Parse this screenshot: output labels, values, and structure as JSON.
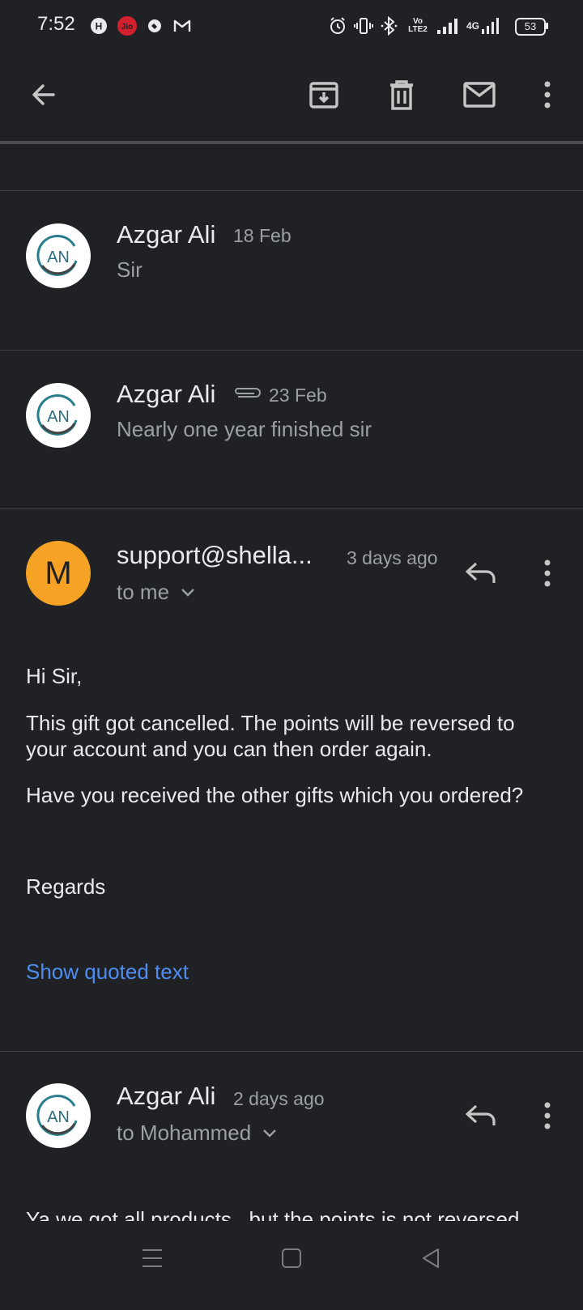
{
  "status_bar": {
    "time": "7:52",
    "carrier_badge": "Jio",
    "volte_label": "Vo LTE2",
    "net_label": "4G",
    "battery": "53"
  },
  "toolbar": {
    "back_icon": "arrow-left-icon",
    "archive_icon": "archive-icon",
    "delete_icon": "trash-icon",
    "mark_unread_icon": "mail-icon",
    "more_icon": "more-vert-icon"
  },
  "messages": [
    {
      "sender": "Azgar Ali",
      "date": "18 Feb",
      "snippet": "Sir",
      "avatar": "AN"
    },
    {
      "sender": "Azgar Ali",
      "date": "23 Feb",
      "snippet": "Nearly one year finished sir",
      "avatar": "AN",
      "has_attachment": true
    }
  ],
  "open_message": {
    "sender": "support@shella...",
    "date": "3 days ago",
    "recipient": "to me",
    "avatar_letter": "M",
    "avatar_color": "#f6a224",
    "body": {
      "greeting": "Hi Sir,",
      "para1": "This gift got cancelled. The points will be reversed to your account and you can then order again.",
      "para2": "Have you received the other gifts which you ordered?",
      "signoff": "Regards"
    },
    "show_quoted": "Show quoted text"
  },
  "reply_message": {
    "sender": "Azgar Ali",
    "date": "2 days ago",
    "recipient": "to Mohammed",
    "avatar": "AN",
    "body_preview": "Ya we got all products , but the points is not reversed"
  },
  "colors": {
    "background": "#202124",
    "link": "#4e8df0",
    "secondary_text": "#9aa0a6"
  }
}
